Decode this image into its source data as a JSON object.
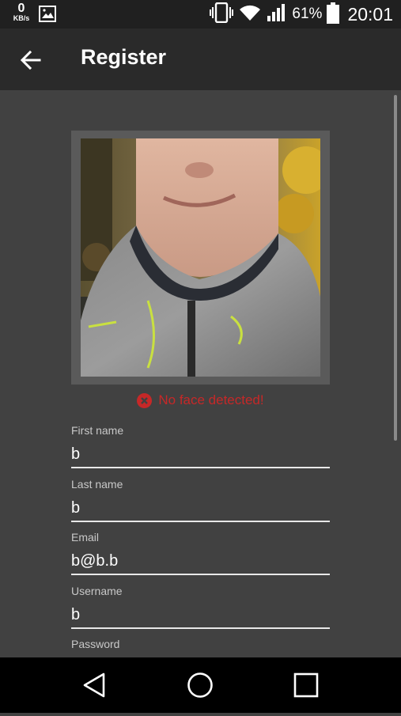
{
  "status_bar": {
    "speed_value": "0",
    "speed_unit": "KB/s",
    "battery_percent": "61%",
    "time": "20:01",
    "icons": [
      "gallery-icon",
      "vibrate-icon",
      "wifi-icon",
      "signal-icon",
      "battery-icon"
    ]
  },
  "app_bar": {
    "title": "Register",
    "back_icon": "arrow-back-icon"
  },
  "photo": {
    "error_icon": "error-circle-icon",
    "error_text": "No face detected!",
    "error_color": "#c62828"
  },
  "form": {
    "first_name": {
      "label": "First name",
      "value": "b"
    },
    "last_name": {
      "label": "Last name",
      "value": "b"
    },
    "email": {
      "label": "Email",
      "value": "b@b.b"
    },
    "username": {
      "label": "Username",
      "value": "b"
    },
    "password": {
      "label": "Password",
      "value": ""
    }
  },
  "nav_bar": {
    "back_icon": "nav-back-triangle-icon",
    "home_icon": "nav-home-circle-icon",
    "recents_icon": "nav-recents-square-icon"
  }
}
